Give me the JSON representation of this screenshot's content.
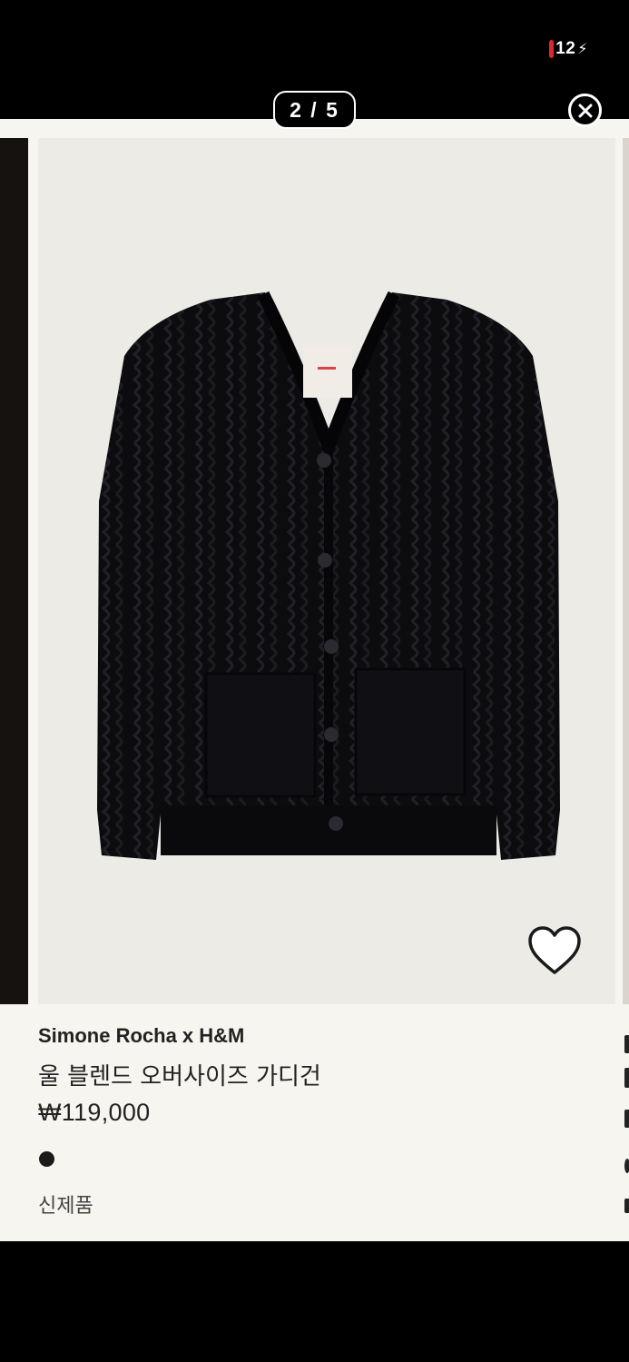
{
  "status_bar": {
    "battery_level": "12",
    "battery_color": "#e0262b"
  },
  "gallery": {
    "page_indicator": "2 / 5",
    "current_page": 2,
    "total_pages": 5
  },
  "icons": {
    "close": "close-icon",
    "wishlist": "heart-outline-icon",
    "charging": "lightning-bolt-icon"
  },
  "product": {
    "brand": "Simone Rocha x H&M",
    "title": "울 블렌드 오버사이즈 가디건",
    "price": "₩119,000",
    "color_swatch": "#1a1a1a",
    "badge": "신제품"
  }
}
